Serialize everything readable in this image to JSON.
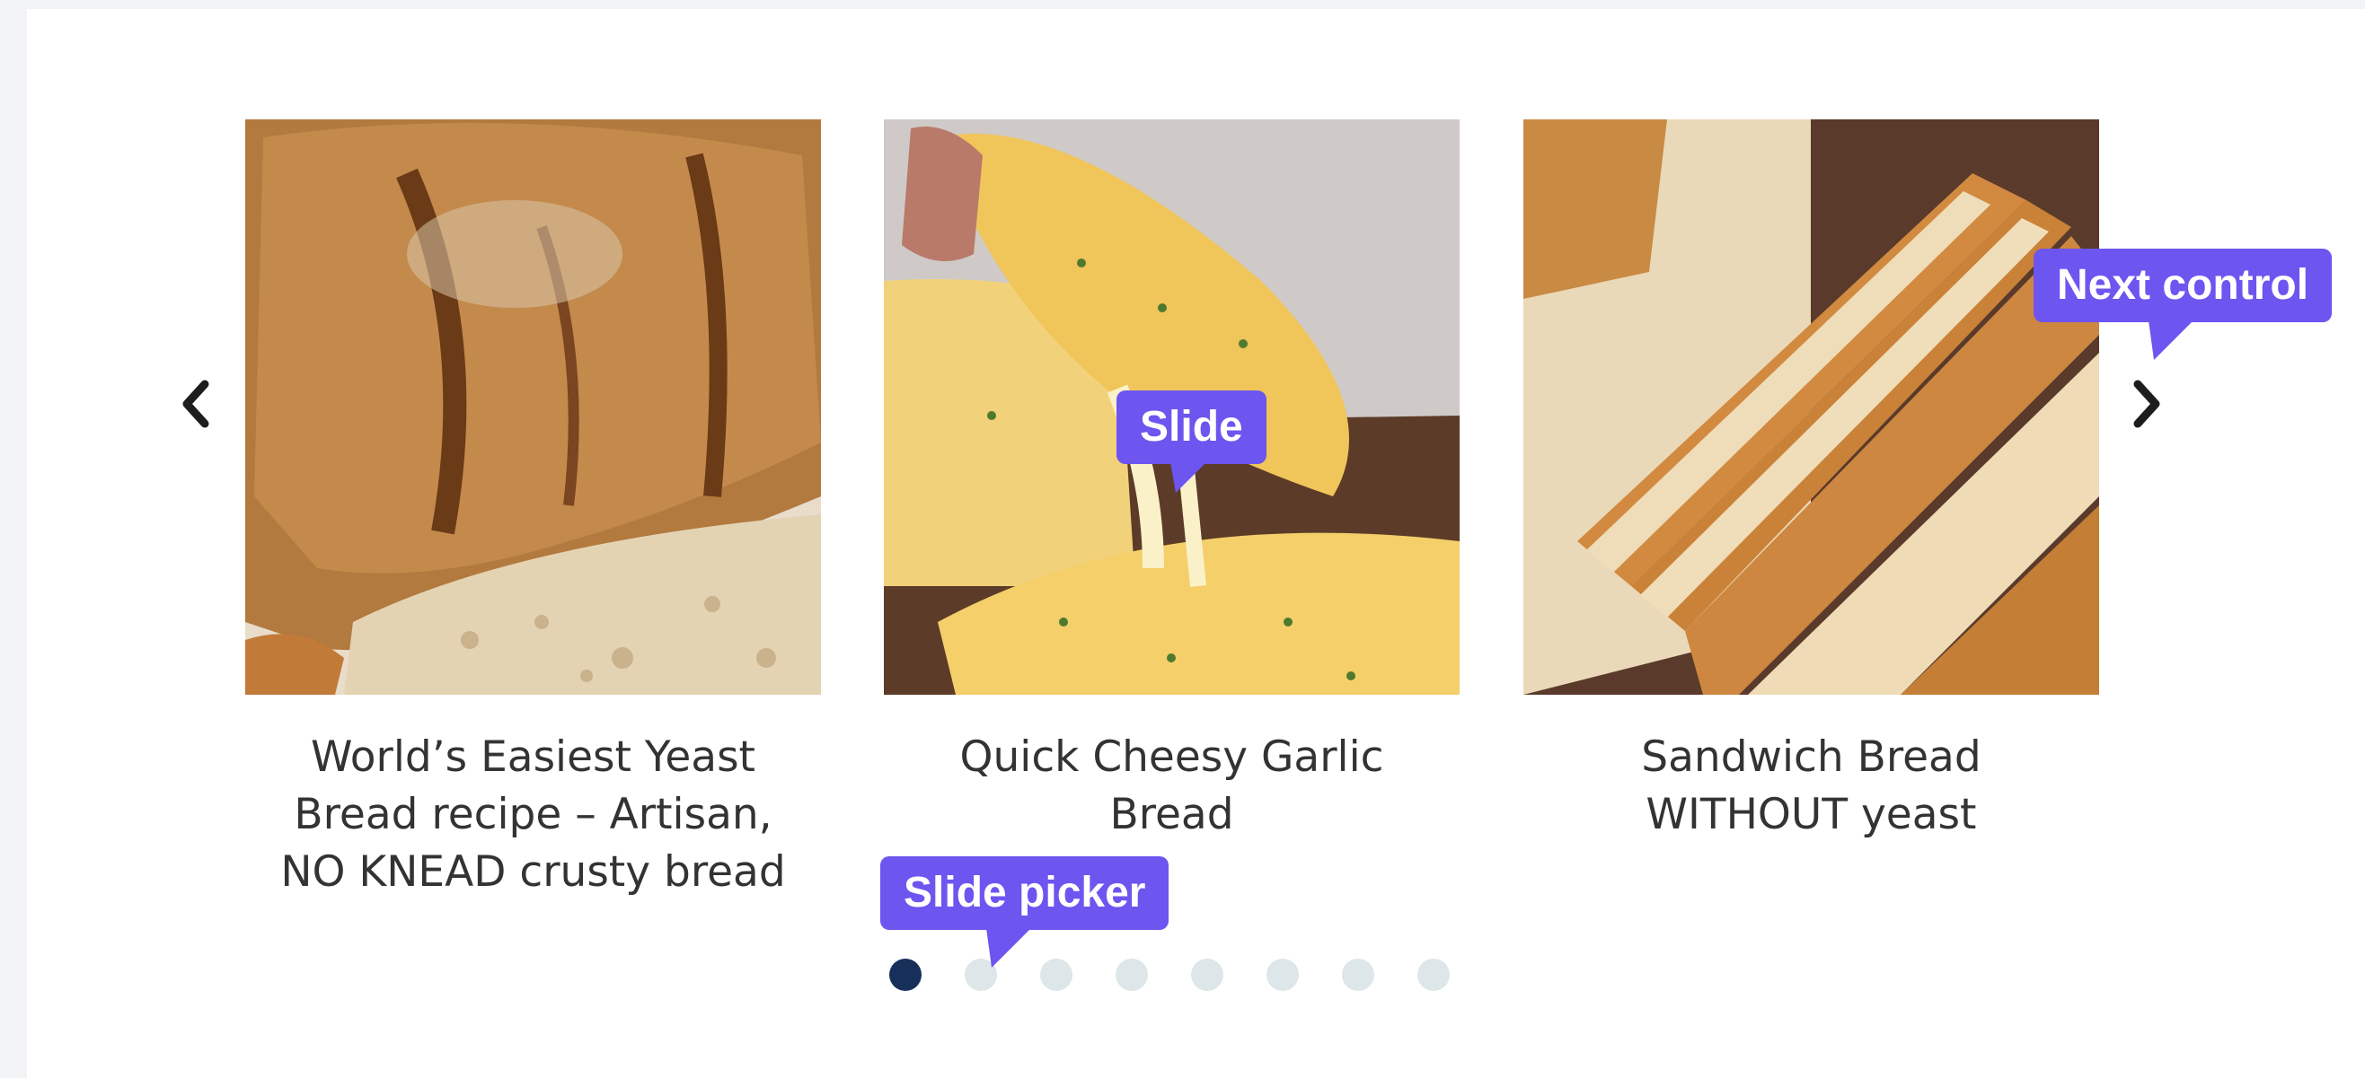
{
  "carousel": {
    "slides": [
      {
        "title": "World’s Easiest Yeast Bread recipe – Artisan, NO KNEAD crusty bread",
        "image": "artisan-bread-photo"
      },
      {
        "title": "Quick Cheesy Garlic Bread",
        "image": "cheesy-garlic-bread-photo"
      },
      {
        "title": "Sandwich Bread WITHOUT yeast",
        "image": "sliced-sandwich-bread-photo"
      }
    ],
    "prev_icon": "chevron-left-icon",
    "next_icon": "chevron-right-icon",
    "dots_count": 8,
    "active_dot": 1
  },
  "annotations": {
    "slide": "Slide",
    "next_control": "Next control",
    "slide_picker": "Slide picker"
  },
  "colors": {
    "accent": "#6d55f0",
    "dot_active": "#17305a",
    "dot_inactive": "#dde6e8",
    "title_text": "#333333"
  }
}
